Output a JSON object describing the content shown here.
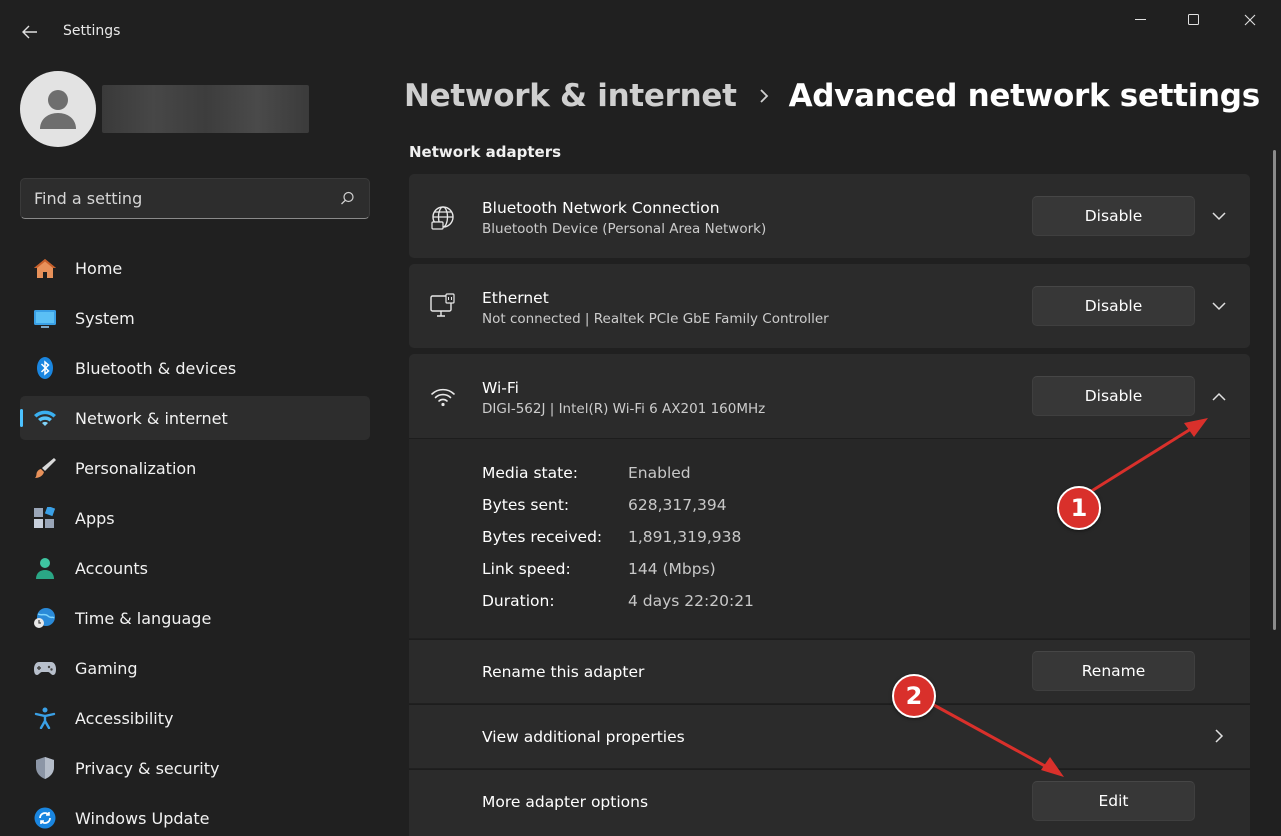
{
  "window": {
    "title": "Settings"
  },
  "search": {
    "placeholder": "Find a setting"
  },
  "sidebar": {
    "items": [
      {
        "label": "Home",
        "icon": "home-icon"
      },
      {
        "label": "System",
        "icon": "system-icon"
      },
      {
        "label": "Bluetooth & devices",
        "icon": "bluetooth-icon"
      },
      {
        "label": "Network & internet",
        "icon": "wifi-icon",
        "active": true
      },
      {
        "label": "Personalization",
        "icon": "brush-icon"
      },
      {
        "label": "Apps",
        "icon": "apps-icon"
      },
      {
        "label": "Accounts",
        "icon": "person-icon"
      },
      {
        "label": "Time & language",
        "icon": "globe-clock-icon"
      },
      {
        "label": "Gaming",
        "icon": "gamepad-icon"
      },
      {
        "label": "Accessibility",
        "icon": "accessibility-icon"
      },
      {
        "label": "Privacy & security",
        "icon": "shield-icon"
      },
      {
        "label": "Windows Update",
        "icon": "update-icon"
      }
    ]
  },
  "breadcrumb": {
    "parent": "Network & internet",
    "current": "Advanced network settings"
  },
  "section": {
    "title": "Network adapters"
  },
  "adapters": [
    {
      "name": "Bluetooth Network Connection",
      "description": "Bluetooth Device (Personal Area Network)",
      "button": "Disable",
      "icon": "globe-network-icon"
    },
    {
      "name": "Ethernet",
      "description": "Not connected | Realtek PCIe GbE Family Controller",
      "button": "Disable",
      "icon": "ethernet-icon"
    },
    {
      "name": "Wi-Fi",
      "description": "DIGI-562J | Intel(R) Wi-Fi 6 AX201 160MHz",
      "button": "Disable",
      "icon": "wifi-icon",
      "expanded": true
    }
  ],
  "wifi_details": [
    {
      "label": "Media state:",
      "value": "Enabled"
    },
    {
      "label": "Bytes sent:",
      "value": "628,317,394"
    },
    {
      "label": "Bytes received:",
      "value": "1,891,319,938"
    },
    {
      "label": "Link speed:",
      "value": "144 (Mbps)"
    },
    {
      "label": "Duration:",
      "value": "4 days 22:20:21"
    }
  ],
  "wifi_actions": {
    "rename_label": "Rename this adapter",
    "rename_button": "Rename",
    "properties_label": "View additional properties",
    "more_label": "More adapter options",
    "more_button": "Edit"
  },
  "annotations": {
    "step1": "1",
    "step2": "2",
    "color": "#d9302b"
  },
  "colors": {
    "accent": "#4cc2ff",
    "background": "#202020",
    "card": "#2b2b2b"
  }
}
